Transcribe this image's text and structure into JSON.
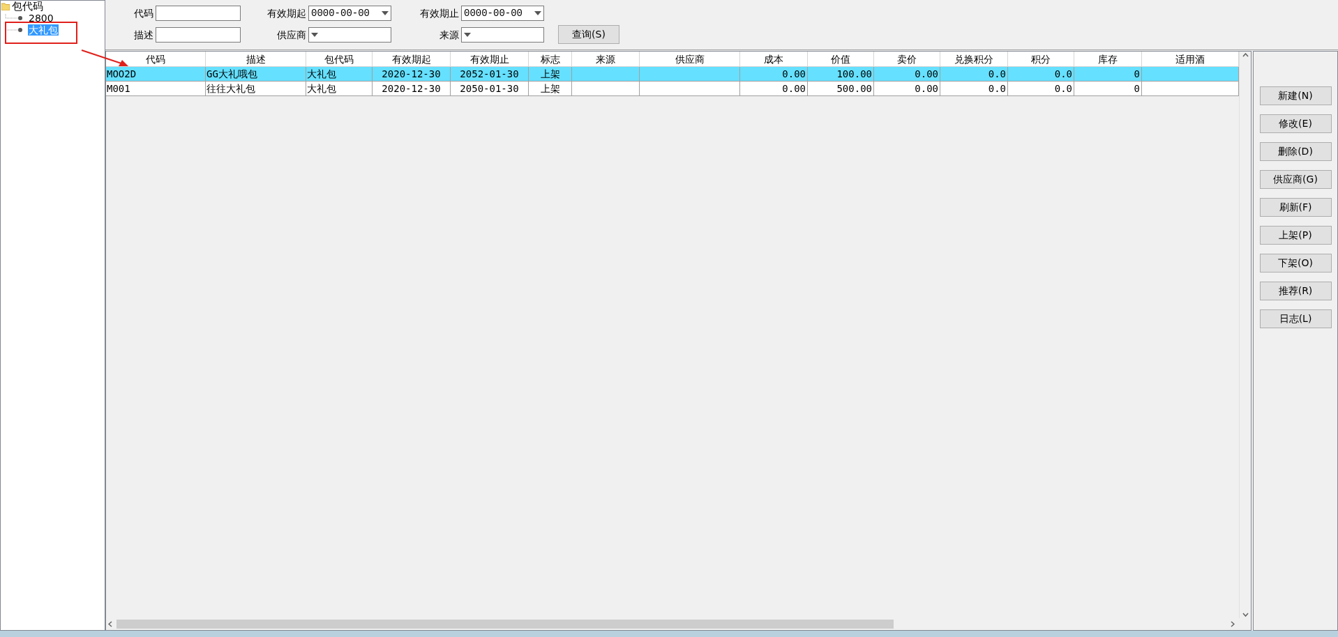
{
  "tree": {
    "label": "包代码",
    "children": [
      {
        "label": "2800",
        "selected": false
      },
      {
        "label": "大礼包",
        "selected": true
      }
    ]
  },
  "filters": [
    {
      "label": "代码",
      "kind": "text"
    },
    {
      "label": "有效期起",
      "kind": "combo",
      "value": "0000-00-00"
    },
    {
      "label": "有效期止",
      "kind": "combo",
      "value": "0000-00-00"
    },
    {
      "label": "描述",
      "kind": "text"
    },
    {
      "label": "供应商",
      "kind": "combo"
    },
    {
      "label": "来源",
      "kind": "combo"
    }
  ],
  "query_button": "查询(S)",
  "table": {
    "columns": [
      "代码",
      "描述",
      "包代码",
      "有效期起",
      "有效期止",
      "标志",
      "来源",
      "供应商",
      "成本",
      "价值",
      "卖价",
      "兑换积分",
      "积分",
      "库存",
      "适用酒"
    ],
    "rows": [
      {
        "selected": true,
        "cells": [
          "MOO2D",
          "GG大礼哦包",
          "大礼包",
          "2020-12-30",
          "2052-01-30",
          "上架",
          null,
          null,
          "0.00",
          "100.00",
          "0.00",
          "0.0",
          "0.0",
          "0",
          null
        ]
      },
      {
        "selected": false,
        "cells": [
          "M001",
          "往往大礼包",
          "大礼包",
          "2020-12-30",
          "2050-01-30",
          "上架",
          null,
          null,
          "0.00",
          "500.00",
          "0.00",
          "0.0",
          "0.0",
          "0",
          null
        ]
      }
    ]
  },
  "buttons": [
    "新建(N)",
    "修改(E)",
    "删除(D)",
    "供应商(G)",
    "刷新(F)",
    "上架(P)",
    "下架(O)",
    "推荐(R)",
    "日志(L)"
  ]
}
